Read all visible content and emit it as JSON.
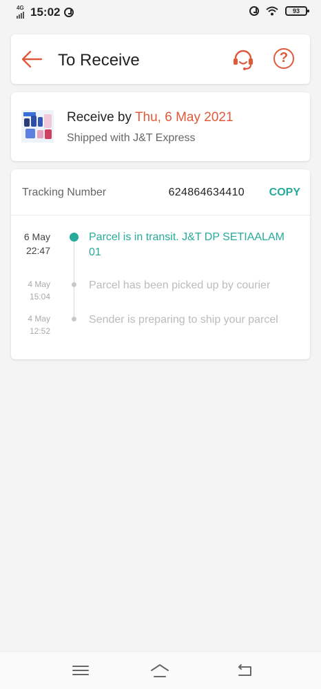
{
  "status_bar": {
    "network": "4G",
    "time": "15:02",
    "battery": "93"
  },
  "header": {
    "title": "To Receive",
    "accent_color": "#e0583a",
    "icons": [
      "back-arrow-icon",
      "customer-support-icon",
      "help-icon"
    ],
    "help_glyph": "?"
  },
  "delivery": {
    "receive_prefix": "Receive by ",
    "receive_date": "Thu, 6 May 2021",
    "shipped_with": "Shipped with J&T Express"
  },
  "tracking": {
    "label": "Tracking Number",
    "number": "624864634410",
    "copy_label": "COPY",
    "accent_color": "#26aa99",
    "events": [
      {
        "date": "6 May",
        "time": "22:47",
        "text": "Parcel is in transit. J&T DP SETIAALAM 01",
        "active": true
      },
      {
        "date": "4 May",
        "time": "15:04",
        "text": "Parcel has been picked up by courier",
        "active": false
      },
      {
        "date": "4 May",
        "time": "12:52",
        "text": "Sender is preparing to ship your parcel",
        "active": false
      }
    ]
  },
  "nav_bar": {
    "icons": [
      "menu-icon",
      "home-icon",
      "back-icon"
    ]
  }
}
